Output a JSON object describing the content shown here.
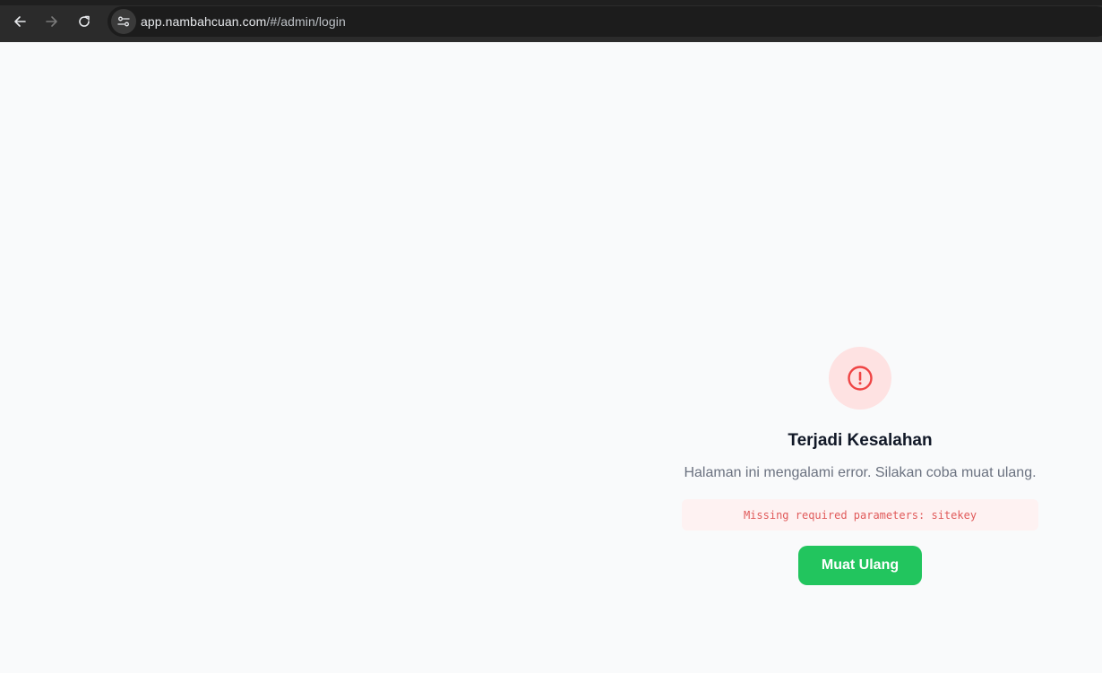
{
  "browser": {
    "url_host": "app.nambahcuan.com",
    "url_path": "/#/admin/login",
    "icons": {
      "back": "arrow-left-icon",
      "forward": "arrow-right-icon",
      "reload": "reload-icon",
      "site_info": "tune-icon"
    }
  },
  "error": {
    "icon": "exclamation-circle-icon",
    "title": "Terjadi Kesalahan",
    "message": "Halaman ini mengalami error. Silakan coba muat ulang.",
    "detail": "Missing required parameters: sitekey",
    "retry_label": "Muat Ulang"
  },
  "colors": {
    "accent_green": "#22c55e",
    "error_red": "#ef4444",
    "error_bg": "#fee2e2",
    "detail_bg": "#fef2f2"
  }
}
